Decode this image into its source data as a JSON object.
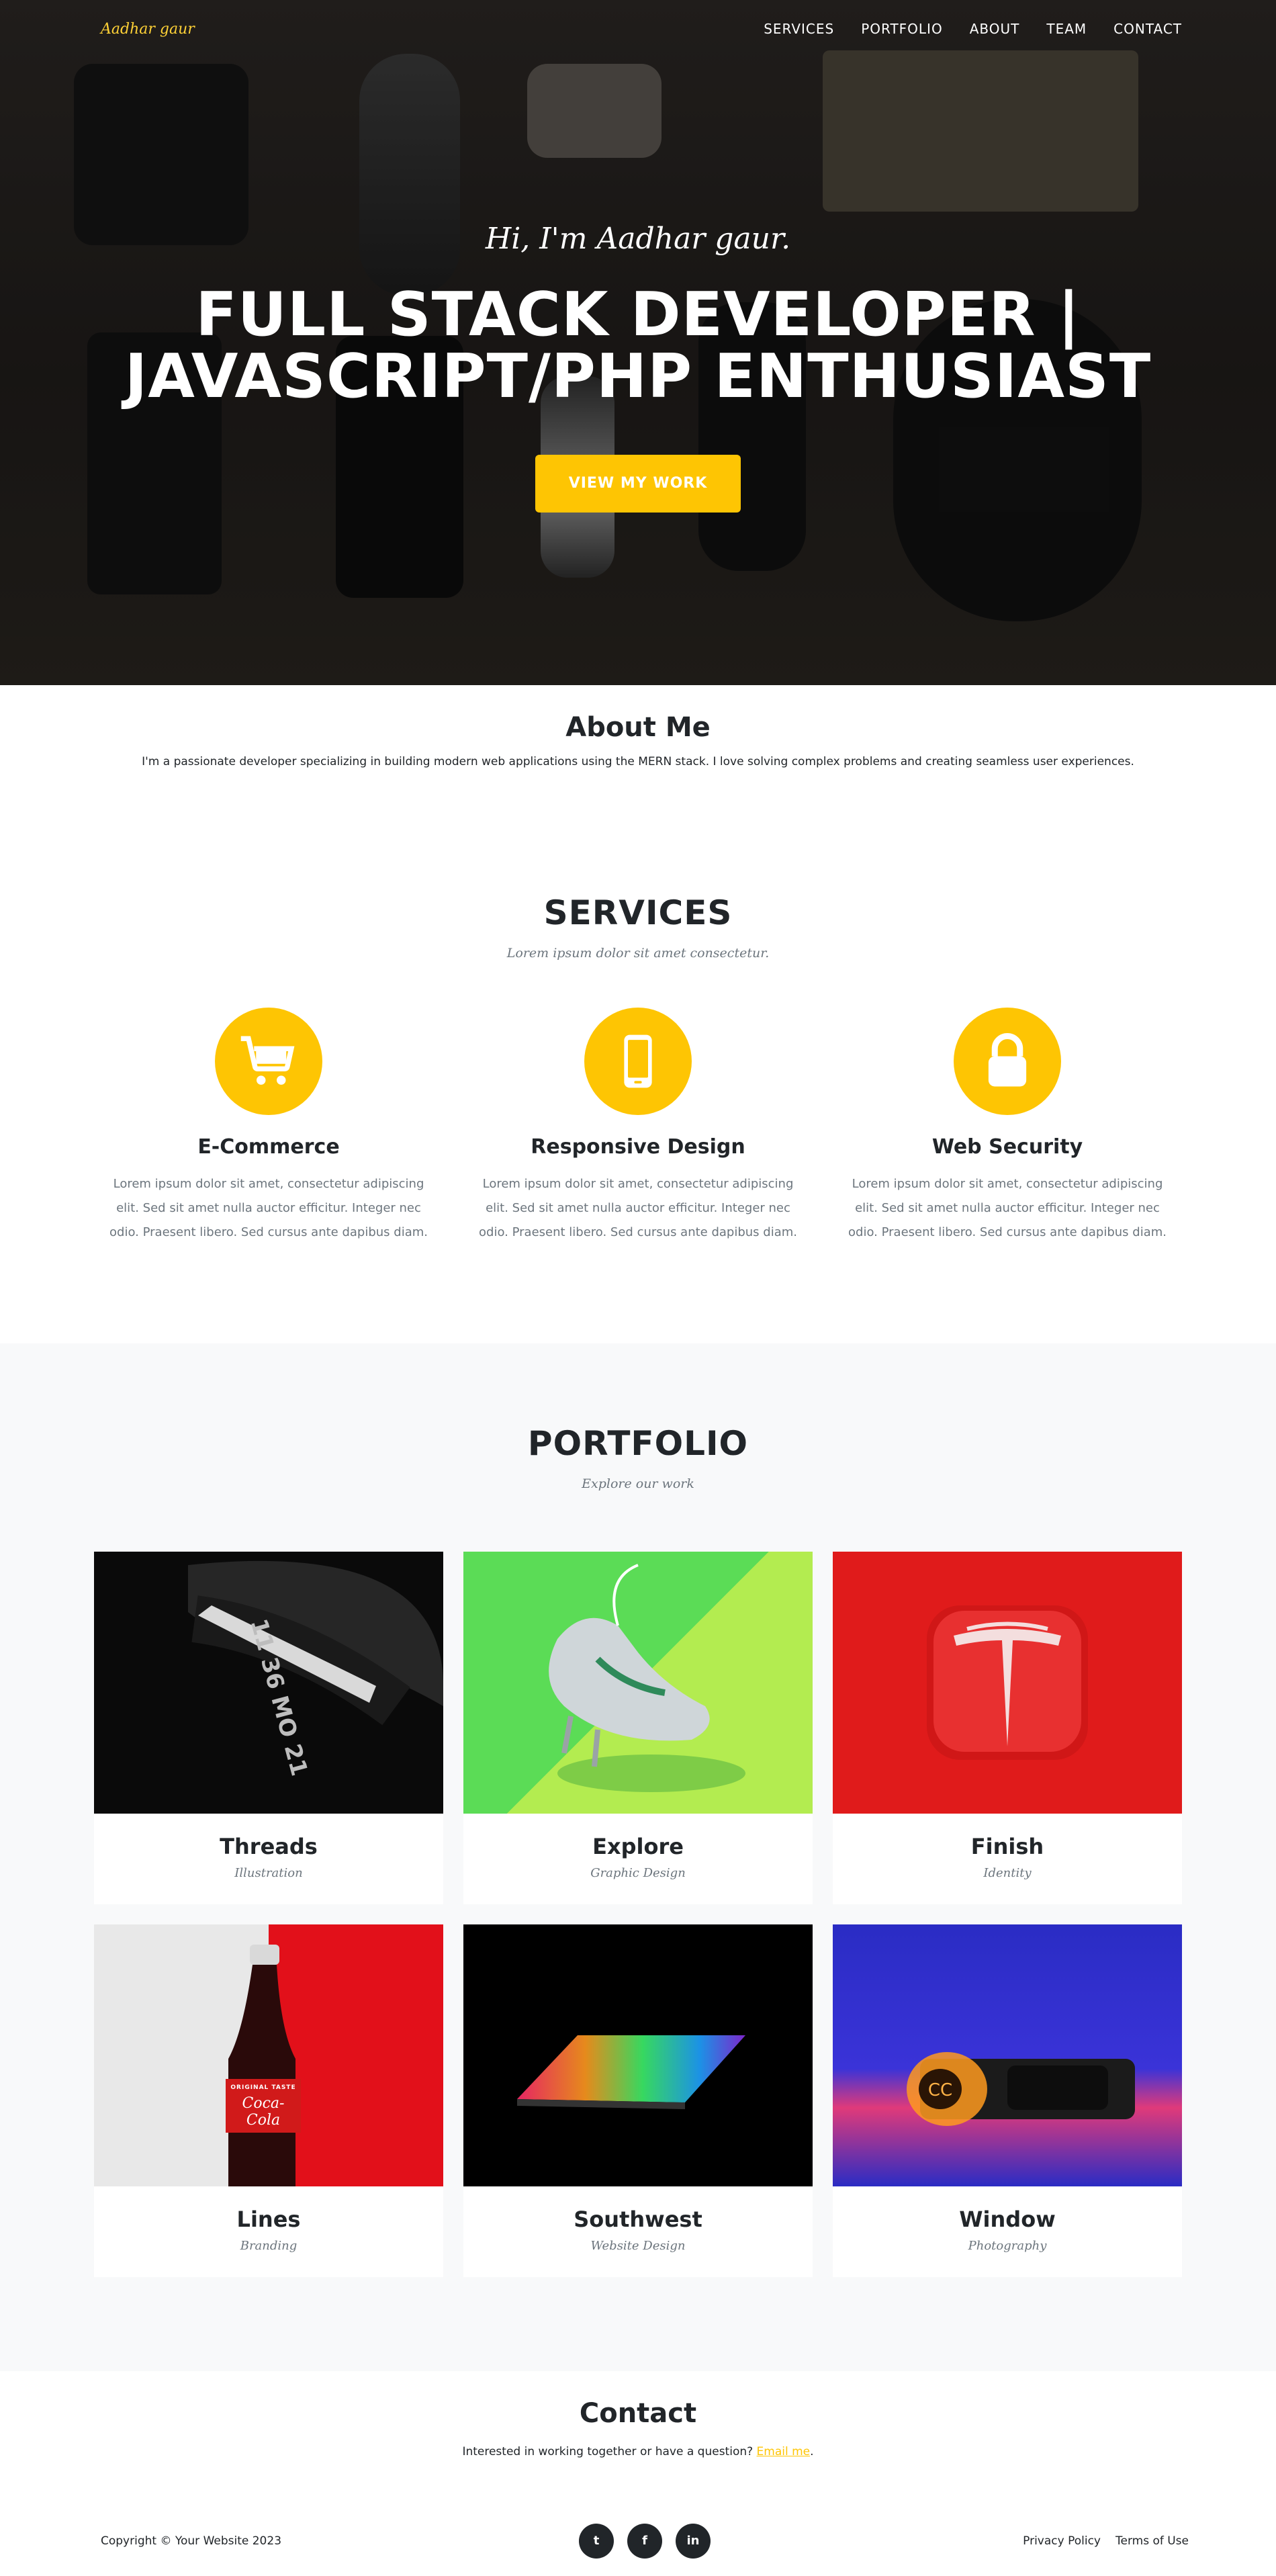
{
  "nav": {
    "brand": "Aadhar gaur",
    "links": [
      "SERVICES",
      "PORTFOLIO",
      "ABOUT",
      "TEAM",
      "CONTACT"
    ]
  },
  "hero": {
    "subtitle": "Hi, I'm Aadhar gaur.",
    "heading_line1": "FULL STACK DEVELOPER |",
    "heading_line2": "JAVASCRIPT/PHP ENTHUSIAST",
    "button": "VIEW MY WORK"
  },
  "about": {
    "title": "About Me",
    "text": "I'm a passionate developer specializing in building modern web applications using the MERN stack. I love solving complex problems and creating seamless user experiences."
  },
  "services": {
    "title": "SERVICES",
    "subtitle": "Lorem ipsum dolor sit amet consectetur.",
    "items": [
      {
        "icon": "shopping-cart-icon",
        "title": "E-Commerce",
        "text": "Lorem ipsum dolor sit amet, consectetur adipiscing elit. Sed sit amet nulla auctor efficitur. Integer nec odio. Praesent libero. Sed cursus ante dapibus diam."
      },
      {
        "icon": "mobile-phone-icon",
        "title": "Responsive Design",
        "text": "Lorem ipsum dolor sit amet, consectetur adipiscing elit. Sed sit amet nulla auctor efficitur. Integer nec odio. Praesent libero. Sed cursus ante dapibus diam."
      },
      {
        "icon": "lock-icon",
        "title": "Web Security",
        "text": "Lorem ipsum dolor sit amet, consectetur adipiscing elit. Sed sit amet nulla auctor efficitur. Integer nec odio. Praesent libero. Sed cursus ante dapibus diam."
      }
    ]
  },
  "portfolio": {
    "title": "PORTFOLIO",
    "subtitle": "Explore our work",
    "items": [
      {
        "title": "Threads",
        "category": "Illustration",
        "watch_text_1": "11",
        "watch_text_2": "36",
        "watch_text_3": "MO",
        "watch_text_4": "21"
      },
      {
        "title": "Explore",
        "category": "Graphic Design"
      },
      {
        "title": "Finish",
        "category": "Identity"
      },
      {
        "title": "Lines",
        "category": "Branding",
        "label_top": "ORIGINAL TASTE",
        "label_logo": "Coca-Cola"
      },
      {
        "title": "Southwest",
        "category": "Website Design"
      },
      {
        "title": "Window",
        "category": "Photography"
      }
    ]
  },
  "contact": {
    "title": "Contact",
    "text": "Interested in working together or have a question? ",
    "link": "Email me",
    "suffix": "."
  },
  "footer": {
    "copyright": "Copyright © Your Website 2023",
    "socials": [
      "twitter-icon",
      "facebook-icon",
      "linkedin-icon"
    ],
    "social_labels": [
      "t",
      "f",
      "in"
    ],
    "links": [
      "Privacy Policy",
      "Terms of Use"
    ]
  },
  "colors": {
    "accent": "#fec503",
    "dark": "#212529",
    "muted": "#6c757d",
    "light_bg": "#f8f9fa"
  }
}
